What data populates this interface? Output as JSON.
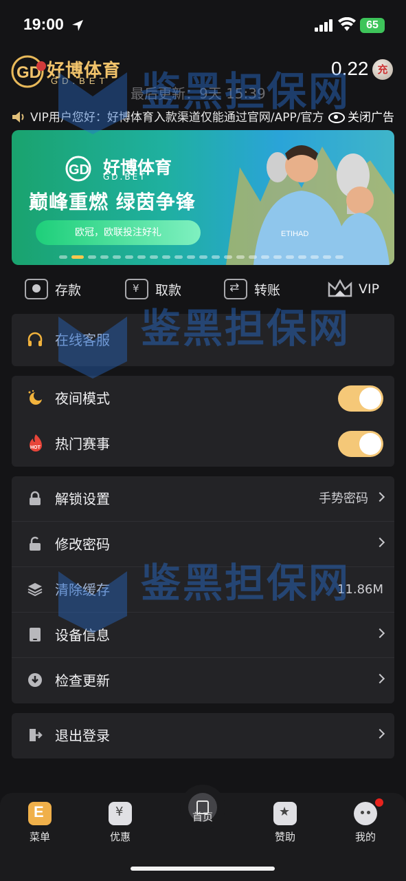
{
  "status_bar": {
    "time": "19:00",
    "battery": "65"
  },
  "header": {
    "logo_text": "好博体育",
    "logo_sub": "GD.BET",
    "balance": "0.22",
    "charge_label": "充",
    "update_text": "最后更新：9天 15:39"
  },
  "marquee": {
    "text": "VIP用户您好：好博体育入款渠道仅能通过官网/APP/官方",
    "close_ad": "关闭广告"
  },
  "banner": {
    "logo_text": "好博体育",
    "logo_sub": "GD.BET",
    "slogan": "巅峰重燃  绿茵争锋",
    "pill": "欧冠，欧联投注好礼",
    "sponsor": "ETIHAD",
    "total_slides": 23,
    "active_slide": 2
  },
  "quick_actions": [
    {
      "label": "存款"
    },
    {
      "label": "取款"
    },
    {
      "label": "转账"
    },
    {
      "label": "VIP"
    }
  ],
  "menu": {
    "service": {
      "label": "在线客服"
    },
    "night_mode": {
      "label": "夜间模式",
      "on": true
    },
    "hot_events": {
      "label": "热门赛事",
      "on": true,
      "badge": "HOT"
    },
    "unlock": {
      "label": "解锁设置",
      "value": "手势密码"
    },
    "change_password": {
      "label": "修改密码"
    },
    "clear_cache": {
      "label": "清除缓存",
      "value": "11.86M"
    },
    "device_info": {
      "label": "设备信息"
    },
    "check_update": {
      "label": "检查更新"
    },
    "logout": {
      "label": "退出登录"
    }
  },
  "tabbar": [
    {
      "label": "菜单"
    },
    {
      "label": "优惠"
    },
    {
      "label": "首页"
    },
    {
      "label": "赞助"
    },
    {
      "label": "我的"
    }
  ],
  "watermark": "鉴黑担保网",
  "colors": {
    "accent": "#f5c878",
    "background": "#141416",
    "card": "#232326"
  }
}
